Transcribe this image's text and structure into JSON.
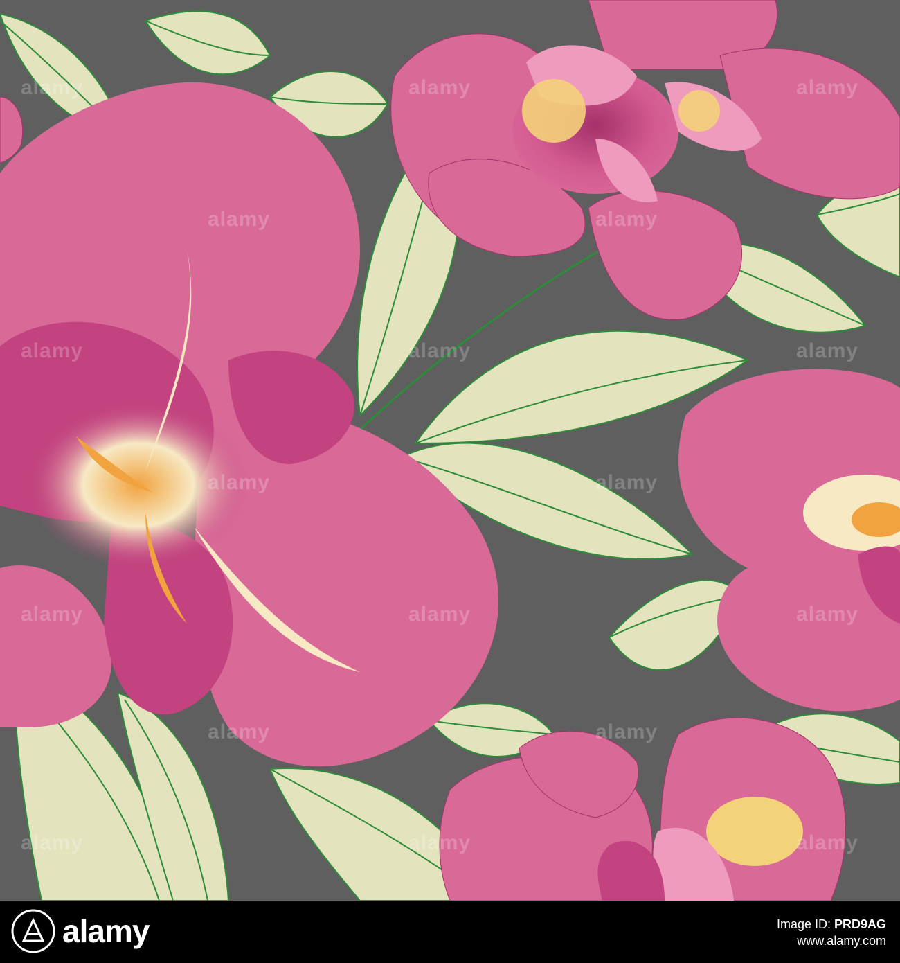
{
  "image": {
    "subject": "seamless floral pattern",
    "colors": {
      "background": "#5f5f60",
      "petal_pink": "#d96a98",
      "petal_magenta": "#c2437f",
      "petal_deep": "#a4316a",
      "petal_light": "#ef9bbd",
      "center_cream": "#f7e9c4",
      "center_orange": "#f1a33f",
      "stamen_yellow": "#f3d27a",
      "leaf_fill": "#e3e4bd",
      "leaf_fill_pale": "#f0f0c8",
      "leaf_vein": "#2e8b3a"
    }
  },
  "watermark": {
    "text": "alamy"
  },
  "footer": {
    "brand": "alamy",
    "image_id_label": "Image ID: ",
    "image_id": "PRD9AG",
    "url": "www.alamy.com"
  }
}
